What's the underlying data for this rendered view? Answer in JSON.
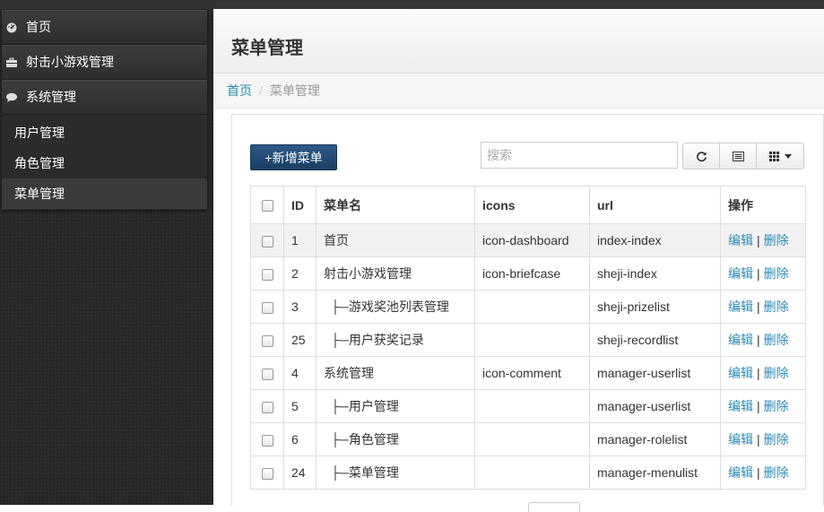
{
  "sidebar": {
    "items": [
      {
        "label": "首页",
        "icon": "dashboard-icon"
      },
      {
        "label": "射击小游戏管理",
        "icon": "briefcase-icon"
      },
      {
        "label": "系统管理",
        "icon": "comment-icon"
      }
    ],
    "subitems": [
      {
        "label": "用户管理"
      },
      {
        "label": "角色管理"
      },
      {
        "label": "菜单管理",
        "active": true
      }
    ]
  },
  "header": {
    "title": "菜单管理"
  },
  "breadcrumb": {
    "home": "首页",
    "current": "菜单管理"
  },
  "toolbar": {
    "add_label": "+新增菜单",
    "search_placeholder": "搜索",
    "icons": [
      "refresh-icon",
      "list-icon",
      "columns-icon"
    ]
  },
  "table": {
    "headers": {
      "id": "ID",
      "name": "菜单名",
      "icons": "icons",
      "url": "url",
      "ops": "操作"
    },
    "rows": [
      {
        "id": "1",
        "name": "首页",
        "icons": "icon-dashboard",
        "url": "index-index"
      },
      {
        "id": "2",
        "name": "射击小游戏管理",
        "icons": "icon-briefcase",
        "url": "sheji-index"
      },
      {
        "id": "3",
        "name": "├─游戏奖池列表管理",
        "icons": "",
        "url": "sheji-prizelist"
      },
      {
        "id": "25",
        "name": "├─用户获奖记录",
        "icons": "",
        "url": "sheji-recordlist"
      },
      {
        "id": "4",
        "name": "系统管理",
        "icons": "icon-comment",
        "url": "manager-userlist"
      },
      {
        "id": "5",
        "name": "├─用户管理",
        "icons": "",
        "url": "manager-userlist"
      },
      {
        "id": "6",
        "name": "├─角色管理",
        "icons": "",
        "url": "manager-rolelist"
      },
      {
        "id": "24",
        "name": "├─菜单管理",
        "icons": "",
        "url": "manager-menulist"
      }
    ],
    "edit_label": "编辑",
    "sep": "|",
    "delete_label": "删除"
  },
  "colors": {
    "accent": "#2a8ab8",
    "button": "#1f4a73",
    "sidebar": "#2b2b2b"
  }
}
